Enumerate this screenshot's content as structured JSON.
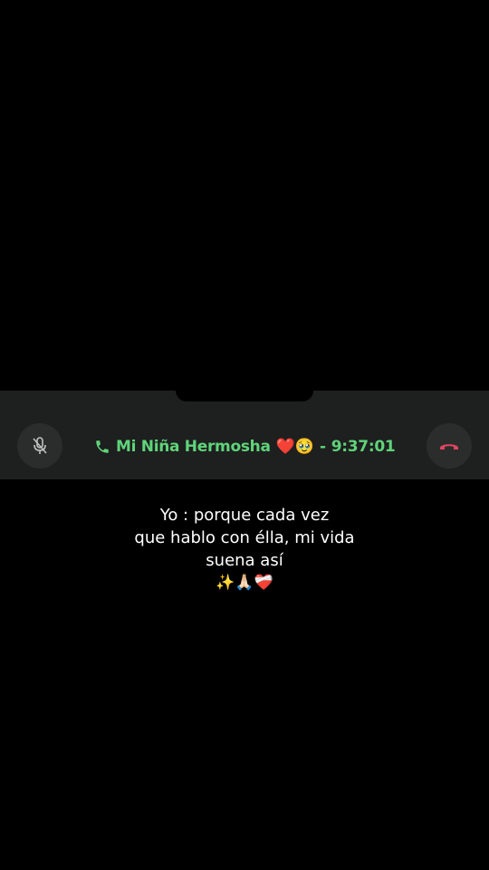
{
  "call": {
    "contact_name": "Mi Niña Hermosha",
    "contact_emojis": "❤️🥹",
    "separator": "-",
    "duration": "9:37:01",
    "accent_color": "#5fd47a",
    "end_call_color": "#e0455e",
    "mute_icon": "microphone-muted-icon",
    "end_icon": "phone-hangup-icon",
    "call_icon": "phone-icon"
  },
  "caption": {
    "lines": [
      "Yo : porque cada vez",
      "que hablo con élla, mi vida",
      "suena así",
      "✨🙏🏻❤️‍🩹"
    ]
  }
}
